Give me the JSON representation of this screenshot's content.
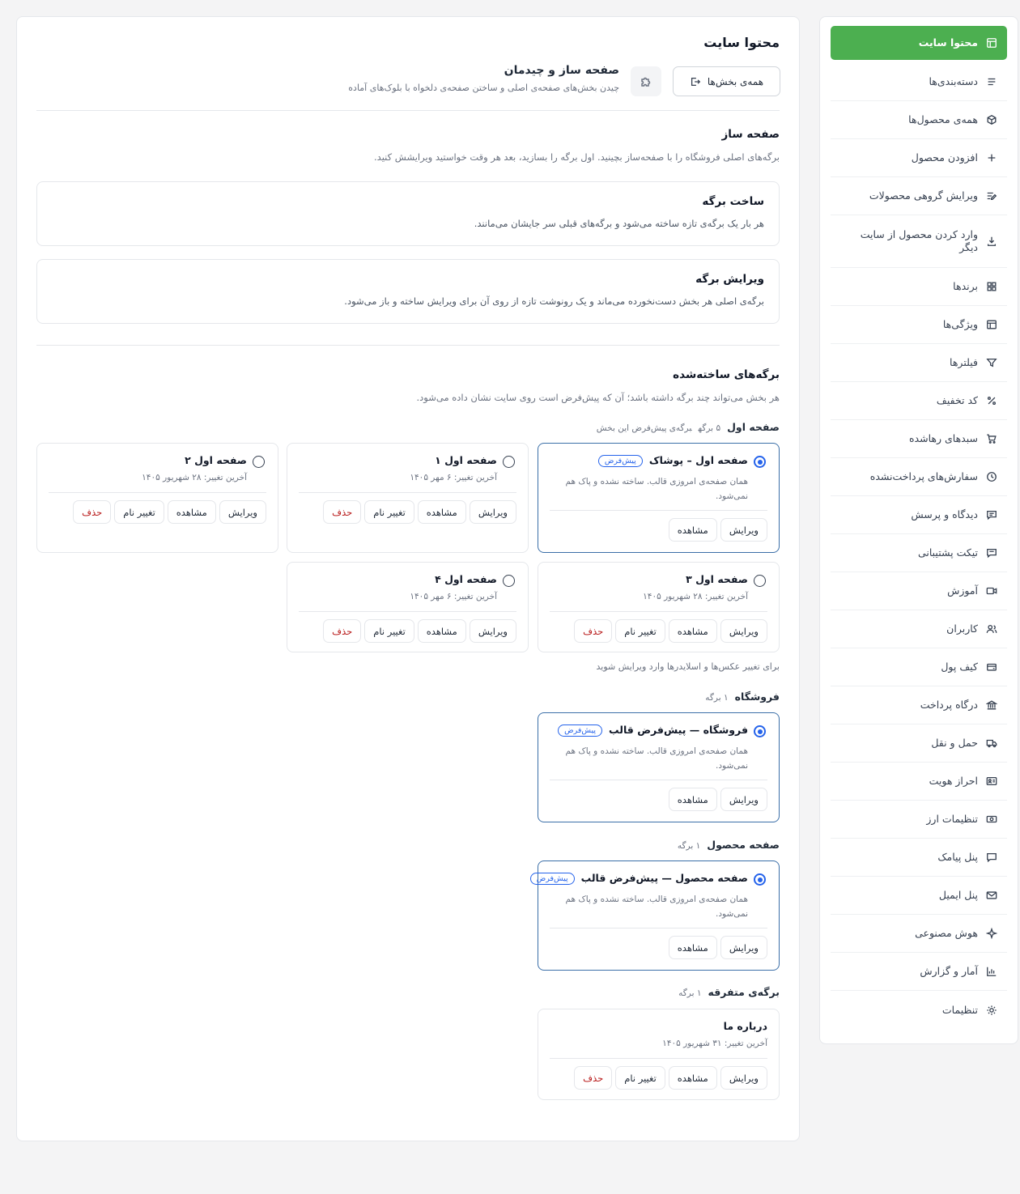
{
  "sidebar": {
    "items": [
      {
        "label": "محتوا سایت",
        "icon": "layout-icon",
        "active": true
      },
      {
        "label": "دسته‌بندی‌ها",
        "icon": "list-icon"
      },
      {
        "label": "همه‌ی محصول‌ها",
        "icon": "box-icon"
      },
      {
        "label": "افزودن محصول",
        "icon": "plus-icon"
      },
      {
        "label": "ویرایش گروهی محصولات",
        "icon": "list-edit-icon"
      },
      {
        "label": "وارد کردن محصول از سایت دیگر",
        "icon": "download-icon"
      },
      {
        "label": "برندها",
        "icon": "grid-icon"
      },
      {
        "label": "ویژگی‌ها",
        "icon": "table-icon"
      },
      {
        "label": "فیلترها",
        "icon": "filter-icon"
      },
      {
        "label": "کد تخفیف",
        "icon": "percent-icon"
      },
      {
        "label": "سبدهای رهاشده",
        "icon": "cart-icon"
      },
      {
        "label": "سفارش‌های پرداخت‌نشده",
        "icon": "clock-icon"
      },
      {
        "label": "دیدگاه و پرسش",
        "icon": "comment-icon"
      },
      {
        "label": "تیکت پشتیبانی",
        "icon": "ticket-icon"
      },
      {
        "label": "آموزش",
        "icon": "video-icon"
      },
      {
        "label": "کاربران",
        "icon": "users-icon"
      },
      {
        "label": "کیف پول",
        "icon": "wallet-icon"
      },
      {
        "label": "درگاه پرداخت",
        "icon": "bank-icon"
      },
      {
        "label": "حمل و نقل",
        "icon": "truck-icon"
      },
      {
        "label": "احراز هویت",
        "icon": "id-card-icon"
      },
      {
        "label": "تنظیمات ارز",
        "icon": "cash-icon"
      },
      {
        "label": "پنل پیامک",
        "icon": "sms-icon"
      },
      {
        "label": "پنل ایمیل",
        "icon": "mail-icon"
      },
      {
        "label": "هوش مصنوعی",
        "icon": "sparkle-icon"
      },
      {
        "label": "آمار و گزارش",
        "icon": "chart-icon"
      },
      {
        "label": "تنظیمات",
        "icon": "gear-icon"
      }
    ]
  },
  "main": {
    "title": "محتوا سایت",
    "header": {
      "title": "صفحه ساز و چیدمان",
      "subtitle": "چیدن بخش‌های صفحه‌ی اصلی و ساختن صفحه‌ی دلخواه با بلوک‌های آماده",
      "all_sections_btn": "همه‌ی بخش‌ها"
    },
    "builder": {
      "title": "صفحه ساز",
      "subtitle": "برگه‌های اصلی فروشگاه را با صفحه‌ساز بچینید. اول برگه را بسازید، بعد هر وقت خواستید ویرایشش کنید.",
      "create": {
        "title": "ساخت برگه",
        "desc": "هر بار یک برگه‌ی تازه ساخته می‌شود و برگه‌های قبلی سر جایشان می‌مانند."
      },
      "edit": {
        "title": "ویرایش برگه",
        "desc": "برگه‌ی اصلی هر بخش دست‌نخورده می‌ماند و یک رونوشت تازه از روی آن برای ویرایش ساخته و باز می‌شود."
      }
    },
    "built": {
      "title": "برگه‌های ساخته‌شده",
      "subtitle": "هر بخش می‌تواند چند برگه داشته باشد؛ آن که پیش‌فرض است روی سایت نشان داده می‌شود."
    },
    "home_group": {
      "label": "صفحه اول",
      "count": "۵ برگه",
      "hint": "برگه‌ی پیش‌فرض این بخش"
    },
    "slider_note": "برای تغییر عکس‌ها و اسلایدرها وارد ویرایش شوید",
    "shop_group": {
      "label": "فروشگاه",
      "count": "۱ برگه"
    },
    "product_group": {
      "label": "صفحه محصول",
      "count": "۱ برگه"
    },
    "misc_group": {
      "label": "برگه‌ی متفرقه",
      "count": "۱ برگه"
    },
    "badge": "پیش‌فرض",
    "default_desc": "همان صفحه‌ی امروزی قالب. ساخته نشده و پاک هم نمی‌شود.",
    "actions": {
      "edit": "ویرایش",
      "view": "مشاهده",
      "rename": "تغییر نام",
      "delete": "حذف"
    },
    "cards": {
      "home_default": {
        "title": "صفحه اول – پوشاک"
      },
      "home1": {
        "title": "صفحه اول ۱",
        "meta": "آخرین تغییر: ۶ مهر ۱۴۰۵"
      },
      "home2": {
        "title": "صفحه اول ۲",
        "meta": "آخرین تغییر: ۲۸ شهریور ۱۴۰۵"
      },
      "home3": {
        "title": "صفحه اول ۳",
        "meta": "آخرین تغییر: ۲۸ شهریور ۱۴۰۵"
      },
      "home4": {
        "title": "صفحه اول ۴",
        "meta": "آخرین تغییر: ۶ مهر ۱۴۰۵"
      },
      "shop_default": {
        "title": "فروشگاه — پیش‌فرض قالب"
      },
      "product_default": {
        "title": "صفحه محصول — پیش‌فرض قالب"
      },
      "about": {
        "title": "درباره ما",
        "meta": "آخرین تغییر: ۳۱ شهریور ۱۴۰۵"
      }
    }
  },
  "colors": {
    "accent": "#4caf50",
    "primary": "#2563eb",
    "danger": "#b91c1c"
  }
}
